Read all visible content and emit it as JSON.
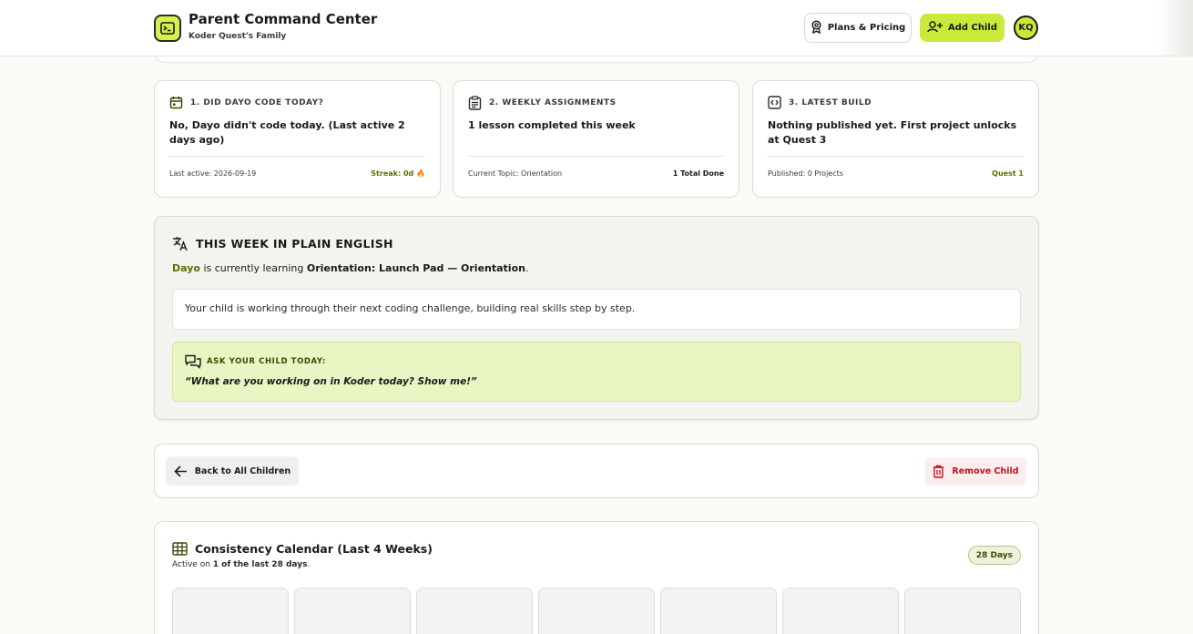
{
  "header": {
    "title": "Parent Command Center",
    "subtitle": "Koder Quest's Family",
    "plans_label": "Plans & Pricing",
    "add_child_label": "Add Child",
    "avatar_initials": "KQ"
  },
  "metrics": [
    {
      "heading": "1. DID DAYO CODE TODAY?",
      "body": "No, Dayo didn't code today. (Last active 2 days ago)",
      "foot_left": "Last active: 2026-09-19",
      "foot_right": "Streak: 0d 🔥",
      "icon": "calendar-icon",
      "foot_right_color": "#5a6e00"
    },
    {
      "heading": "2. WEEKLY ASSIGNMENTS",
      "body": "1 lesson completed this week",
      "foot_left": "Current Topic: Orientation",
      "foot_right": "1 Total Done",
      "icon": "clipboard-icon",
      "foot_right_color": "#1a1a1a"
    },
    {
      "heading": "3. LATEST BUILD",
      "body": "Nothing published yet. First project unlocks at Quest 3",
      "foot_left": "Published: 0 Projects",
      "foot_right": "Quest 1",
      "icon": "code-icon",
      "foot_right_color": "#5a6e00"
    }
  ],
  "plain_english": {
    "heading": "THIS WEEK IN PLAIN ENGLISH",
    "child_name": "Dayo",
    "learning_text": " is currently learning ",
    "topic": "Orientation: Launch Pad — Orientation",
    "period": ".",
    "summary": "Your child is working through their next coding challenge, building real skills step by step.",
    "ask_heading": "ASK YOUR CHILD TODAY:",
    "ask_question": "“What are you working on in Koder today? Show me!”"
  },
  "actions": {
    "back_label": "Back to All Children",
    "remove_label": "Remove Child"
  },
  "calendar": {
    "heading": "Consistency Calendar (Last 4 Weeks)",
    "sub_prefix": "Active on ",
    "sub_bold": "1 of the last 28 days",
    "sub_suffix": ".",
    "badge": "28 Days"
  },
  "colors": {
    "accent": "#c9ea3a",
    "danger": "#c1121f",
    "olive": "#5a6e00"
  }
}
